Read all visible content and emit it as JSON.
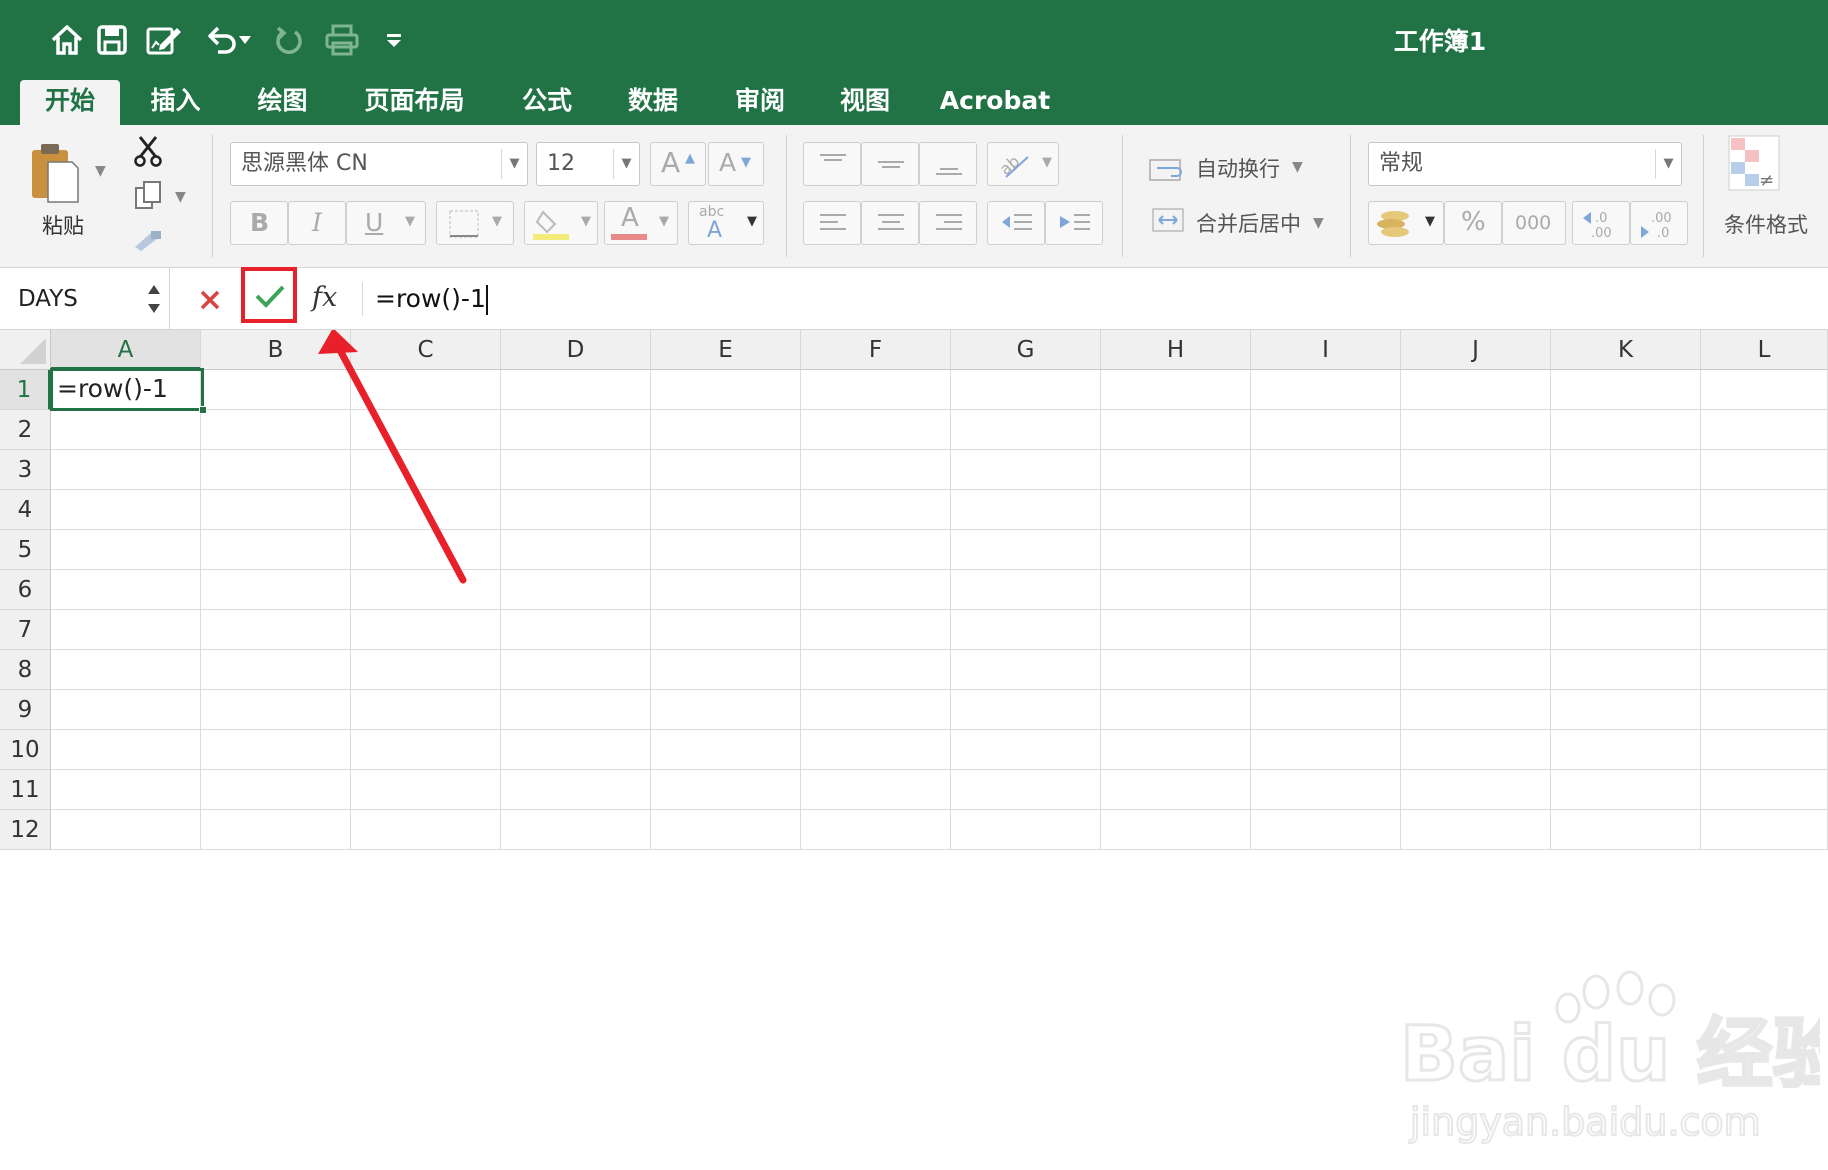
{
  "title_bar": {
    "document_title": "工作簿1",
    "quick_access_icons": [
      "home-icon",
      "save-icon",
      "edit-icon",
      "undo-icon",
      "redo-icon",
      "print-icon",
      "customize-icon"
    ]
  },
  "tabs": [
    {
      "label": "开始",
      "active": true
    },
    {
      "label": "插入"
    },
    {
      "label": "绘图"
    },
    {
      "label": "页面布局"
    },
    {
      "label": "公式"
    },
    {
      "label": "数据"
    },
    {
      "label": "审阅"
    },
    {
      "label": "视图"
    },
    {
      "label": "Acrobat"
    }
  ],
  "ribbon": {
    "paste_label": "粘贴",
    "font_name": "思源黑体 CN",
    "font_size": "12",
    "bold": "B",
    "italic": "I",
    "underline": "U",
    "font_color_glyph": "A",
    "abc_label": "abc",
    "wrap_text": "自动换行",
    "merge_center": "合并后居中",
    "number_format": "常规",
    "percent": "%",
    "thousands": "000",
    "dec_inc": ".0\n.00",
    "dec_dec": ".00\n.0",
    "conditional_format": "条件格式"
  },
  "formula_bar": {
    "name_box": "DAYS",
    "formula": "=row()-1",
    "fx": "fx"
  },
  "grid": {
    "columns": [
      "A",
      "B",
      "C",
      "D",
      "E",
      "F",
      "G",
      "H",
      "I",
      "J",
      "K",
      "L"
    ],
    "rows": [
      "1",
      "2",
      "3",
      "4",
      "5",
      "6",
      "7",
      "8",
      "9",
      "10",
      "11",
      "12"
    ],
    "active_cell_value": "=row()-1"
  },
  "colors": {
    "accent": "#217346",
    "annotation_red": "#e8202a",
    "cancel_red": "#d9433f",
    "enter_green": "#3fa35a"
  },
  "watermark": {
    "brand": "Bai du 经验",
    "url": "jingyan.baidu.com"
  }
}
